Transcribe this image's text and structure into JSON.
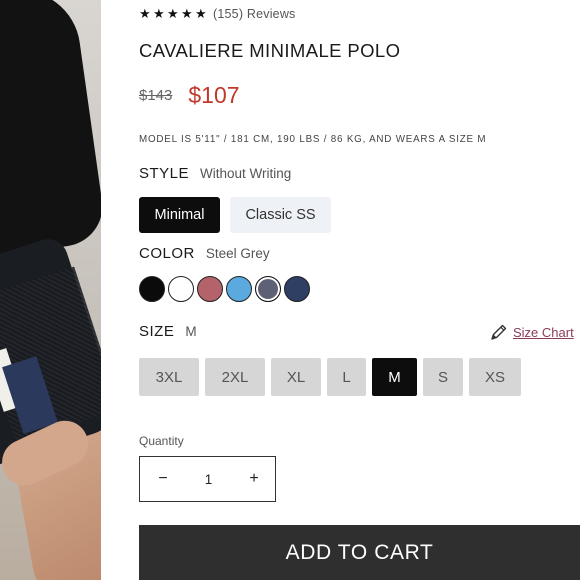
{
  "product": {
    "rating_stars": 5,
    "review_count": "(155)",
    "review_label": "Reviews",
    "title": "CAVALIERE MINIMALE POLO",
    "old_price": "$143",
    "new_price": "$107",
    "model_info": "MODEL IS 5'11\" / 181 CM, 190 LBS / 86 KG, AND WEARS A SIZE M"
  },
  "style": {
    "label": "STYLE",
    "value": "Without Writing",
    "options": [
      "Minimal",
      "Classic SS"
    ],
    "selected": "Minimal"
  },
  "color": {
    "label": "COLOR",
    "value": "Steel Grey",
    "swatches": [
      {
        "name": "black",
        "hex": "#0b0b0b"
      },
      {
        "name": "white",
        "hex": "#ffffff"
      },
      {
        "name": "rose",
        "hex": "#b5636a"
      },
      {
        "name": "sky-blue",
        "hex": "#5aa9df"
      },
      {
        "name": "steel-grey",
        "hex": "#5e6176"
      },
      {
        "name": "navy",
        "hex": "#2f3f63"
      }
    ],
    "selected": "steel-grey"
  },
  "size": {
    "label": "SIZE",
    "value": "M",
    "chart_label": "Size Chart",
    "options": [
      "3XL",
      "2XL",
      "XL",
      "L",
      "M",
      "S",
      "XS"
    ],
    "selected": "M"
  },
  "quantity": {
    "label": "Quantity",
    "value": "1",
    "minus": "−",
    "plus": "+"
  },
  "cart": {
    "label": "ADD TO CART"
  },
  "colors": {
    "accent_price": "#c0392b",
    "size_chart_link": "#8a3b5a",
    "selected_bg": "#0d0d0d",
    "cart_bg": "#2f2f2f"
  }
}
